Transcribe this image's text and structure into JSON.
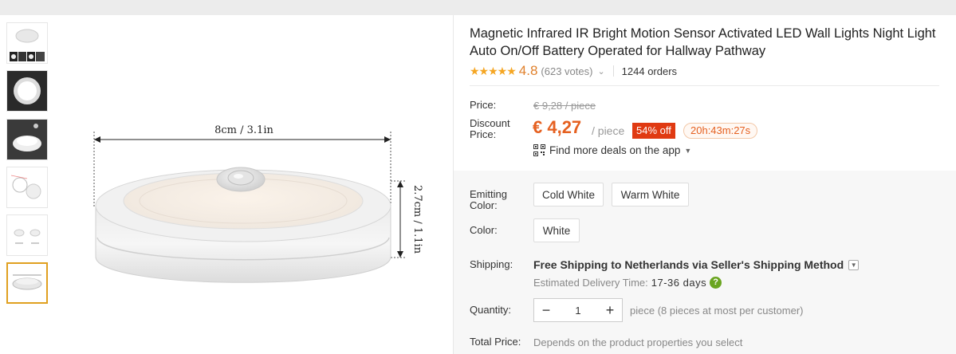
{
  "product": {
    "title": "Magnetic Infrared IR Bright Motion Sensor Activated LED Wall Lights Night Light Auto On/Off Battery Operated for Hallway Pathway",
    "stars": "★★★★★",
    "rating": "4.8",
    "votes": "(623 votes)",
    "orders": "1244 orders"
  },
  "image": {
    "width_label": "8cm / 3.1in",
    "height_label": "2.7cm / 1.1in",
    "thumbnail_count": 6,
    "active_thumbnail": 6
  },
  "pricing": {
    "price_label": "Price:",
    "original_price": "€ 9,28 / piece",
    "discount_label_1": "Discount",
    "discount_label_2": "Price:",
    "price": "€ 4,27",
    "per_piece": "/ piece",
    "discount_badge": "54% off",
    "timer": "20h:43m:27s",
    "app_deals": "Find more deals on the app"
  },
  "options": {
    "emitting_label_1": "Emitting",
    "emitting_label_2": "Color:",
    "emitting_values": [
      "Cold White",
      "Warm White"
    ],
    "color_label": "Color:",
    "color_values": [
      "White"
    ]
  },
  "shipping": {
    "label": "Shipping:",
    "text": "Free Shipping to Netherlands via Seller's Shipping Method",
    "delivery_label": "Estimated Delivery Time:",
    "delivery_value": "17-36 days",
    "help_icon_glyph": "?"
  },
  "quantity": {
    "label": "Quantity:",
    "value": "1",
    "minus": "−",
    "plus": "+",
    "note": "piece (8 pieces at most per customer)"
  },
  "total": {
    "label": "Total Price:",
    "note": "Depends on the product properties you select"
  },
  "colors": {
    "accent": "#e56020",
    "badge": "#e03a12",
    "star": "#f5a623",
    "active_thumb_border": "#e0a020",
    "help_icon": "#6aa520"
  }
}
